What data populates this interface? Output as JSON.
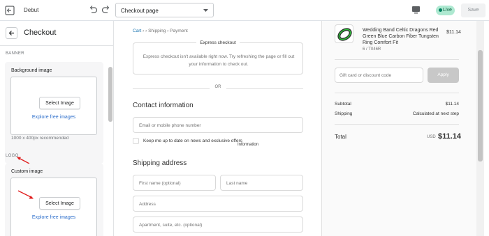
{
  "topbar": {
    "theme_name": "Debut",
    "page_select": "Checkout page",
    "status": "Live",
    "save_label": "Save"
  },
  "sidebar": {
    "title": "Checkout",
    "banner_heading": "BANNER",
    "background_label": "Background image",
    "select_image_label": "Select Image",
    "explore_label": "Explore free images",
    "recommended_note": "1000 x 400px recommended",
    "logo_heading": "LOGO",
    "custom_image_label": "Custom image"
  },
  "checkout": {
    "breadcrumbs": [
      "Cart",
      "Information",
      "Shipping",
      "Payment"
    ],
    "express_title": "Express checkout",
    "express_message": "Express checkout isn't available right now. Try refreshing the page or fill out your information to check out.",
    "or_label": "OR",
    "contact_heading": "Contact information",
    "email_placeholder": "Email or mobile phone number",
    "news_label": "Keep me up to date on news and exclusive offers",
    "shipping_heading": "Shipping address",
    "first_name_placeholder": "First name (optional)",
    "last_name_placeholder": "Last name",
    "address_placeholder": "Address",
    "apartment_placeholder": "Apartment, suite, etc. (optional)"
  },
  "summary": {
    "product_name": "Wedding Band Celtic Dragons Red Green Blue Carbon Fiber Tungsten Ring Comfort Fit",
    "product_variant": "6 / T046R",
    "product_price": "$11.14",
    "discount_placeholder": "Gift card or discount code",
    "apply_label": "Apply",
    "subtotal_label": "Subtotal",
    "subtotal_value": "$11.14",
    "shipping_label": "Shipping",
    "shipping_value": "Calculated at next step",
    "total_label": "Total",
    "currency": "USD",
    "total_value": "$11.14"
  },
  "colors": {
    "link": "#1773b0",
    "live_badge": "#aee9d1",
    "annotation_arrow": "#e02020"
  }
}
